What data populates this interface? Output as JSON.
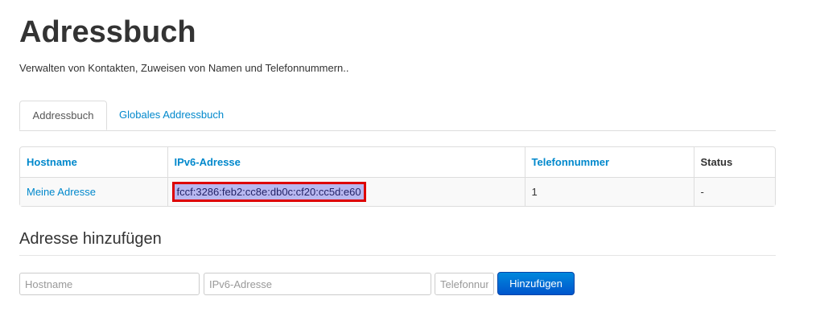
{
  "page": {
    "title": "Adressbuch",
    "subtitle": "Verwalten von Kontakten, Zuweisen von Namen und Telefonnummern.."
  },
  "tabs": [
    {
      "label": "Addressbuch",
      "active": true
    },
    {
      "label": "Globales Addressbuch",
      "active": false
    }
  ],
  "table": {
    "headers": [
      "Hostname",
      "IPv6-Adresse",
      "Telefonnummer",
      "Status"
    ],
    "rows": [
      {
        "hostname": "Meine Adresse",
        "ipv6": "fccf:3286:feb2:cc8e:db0c:cf20:cc5d:e60",
        "telefon": "1",
        "status": "-"
      }
    ]
  },
  "add_form": {
    "title": "Adresse hinzufügen",
    "hostname_placeholder": "Hostname",
    "ipv6_placeholder": "IPv6-Adresse",
    "telefon_placeholder": "Telefonnummer",
    "submit_label": "Hinzufügen"
  },
  "colors": {
    "link": "#0088cc",
    "highlight_bg": "#b8b8f0",
    "highlight_border": "#dd0000",
    "button": "#0066cc"
  }
}
